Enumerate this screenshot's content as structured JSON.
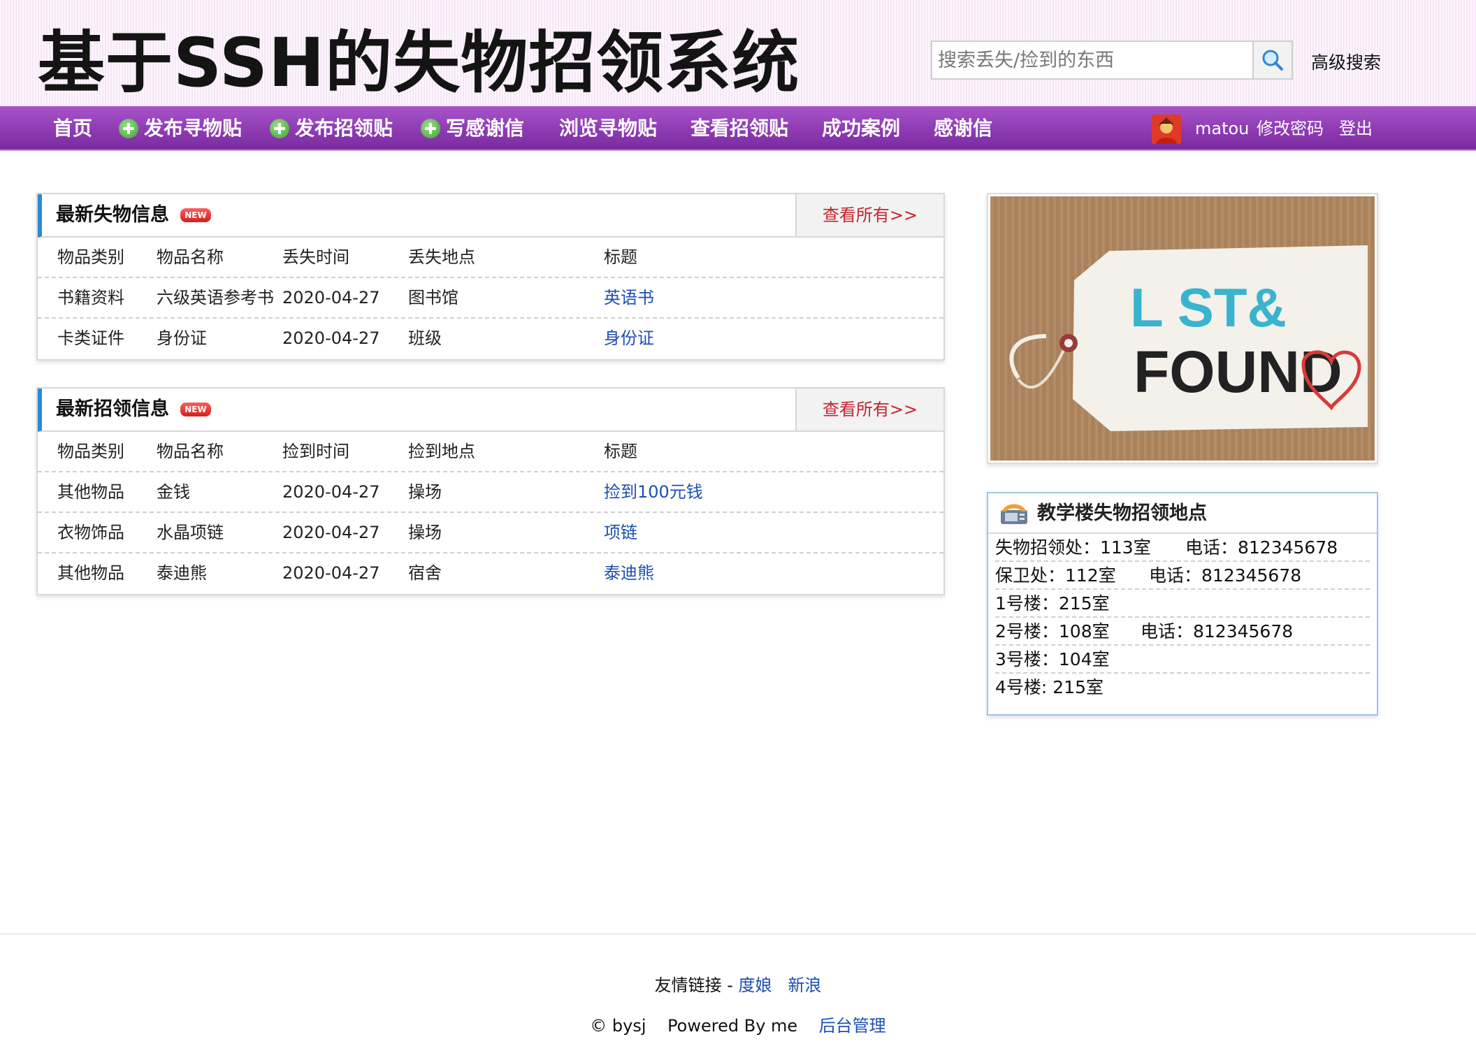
{
  "header": {
    "site_title": "基于SSH的失物招领系统",
    "search_placeholder": "搜索丢失/捡到的东西",
    "advanced_search": "高级搜索"
  },
  "nav": {
    "home": "首页",
    "post_lost": "发布寻物贴",
    "post_found": "发布招领贴",
    "write_thanks": "写感谢信",
    "browse_lost": "浏览寻物贴",
    "view_found": "查看招领贴",
    "success_cases": "成功案例",
    "thanks_letters": "感谢信",
    "username": "matou",
    "change_password": "修改密码",
    "logout": "登出"
  },
  "lost_panel": {
    "title": "最新失物信息",
    "badge": "NEW",
    "view_all": "查看所有>>",
    "headers": [
      "物品类别",
      "物品名称",
      "丢失时间",
      "丢失地点",
      "标题"
    ],
    "rows": [
      {
        "category": "书籍资料",
        "name": "六级英语参考书",
        "time": "2020-04-27",
        "place": "图书馆",
        "title": "英语书"
      },
      {
        "category": "卡类证件",
        "name": "身份证",
        "time": "2020-04-27",
        "place": "班级",
        "title": "身份证"
      }
    ]
  },
  "found_panel": {
    "title": "最新招领信息",
    "badge": "NEW",
    "view_all": "查看所有>>",
    "headers": [
      "物品类别",
      "物品名称",
      "捡到时间",
      "捡到地点",
      "标题"
    ],
    "rows": [
      {
        "category": "其他物品",
        "name": "金钱",
        "time": "2020-04-27",
        "place": "操场",
        "title": "捡到100元钱"
      },
      {
        "category": "衣物饰品",
        "name": "水晶项链",
        "time": "2020-04-27",
        "place": "操场",
        "title": "项链"
      },
      {
        "category": "其他物品",
        "name": "泰迪熊",
        "time": "2020-04-27",
        "place": "宿舍",
        "title": "泰迪熊"
      }
    ]
  },
  "promo": {
    "tag_line1": "L ST&",
    "tag_line2": "FOUND"
  },
  "contact": {
    "title": "教学楼失物招领地点",
    "rows": [
      {
        "place": "失物招领处：113室",
        "phone": "电话：812345678"
      },
      {
        "place": "保卫处：112室",
        "phone": "电话：812345678"
      },
      {
        "place": "1号楼：215室",
        "phone": ""
      },
      {
        "place": "2号楼：108室",
        "phone": "电话：812345678"
      },
      {
        "place": "3号楼：104室",
        "phone": ""
      },
      {
        "place": "4号楼: 215室",
        "phone": ""
      }
    ]
  },
  "footer": {
    "friends_label": "友情链接 -",
    "link1": "度娘",
    "link2": "新浪",
    "copyright": "© bysj",
    "powered": "Powered By me",
    "admin": "后台管理"
  }
}
